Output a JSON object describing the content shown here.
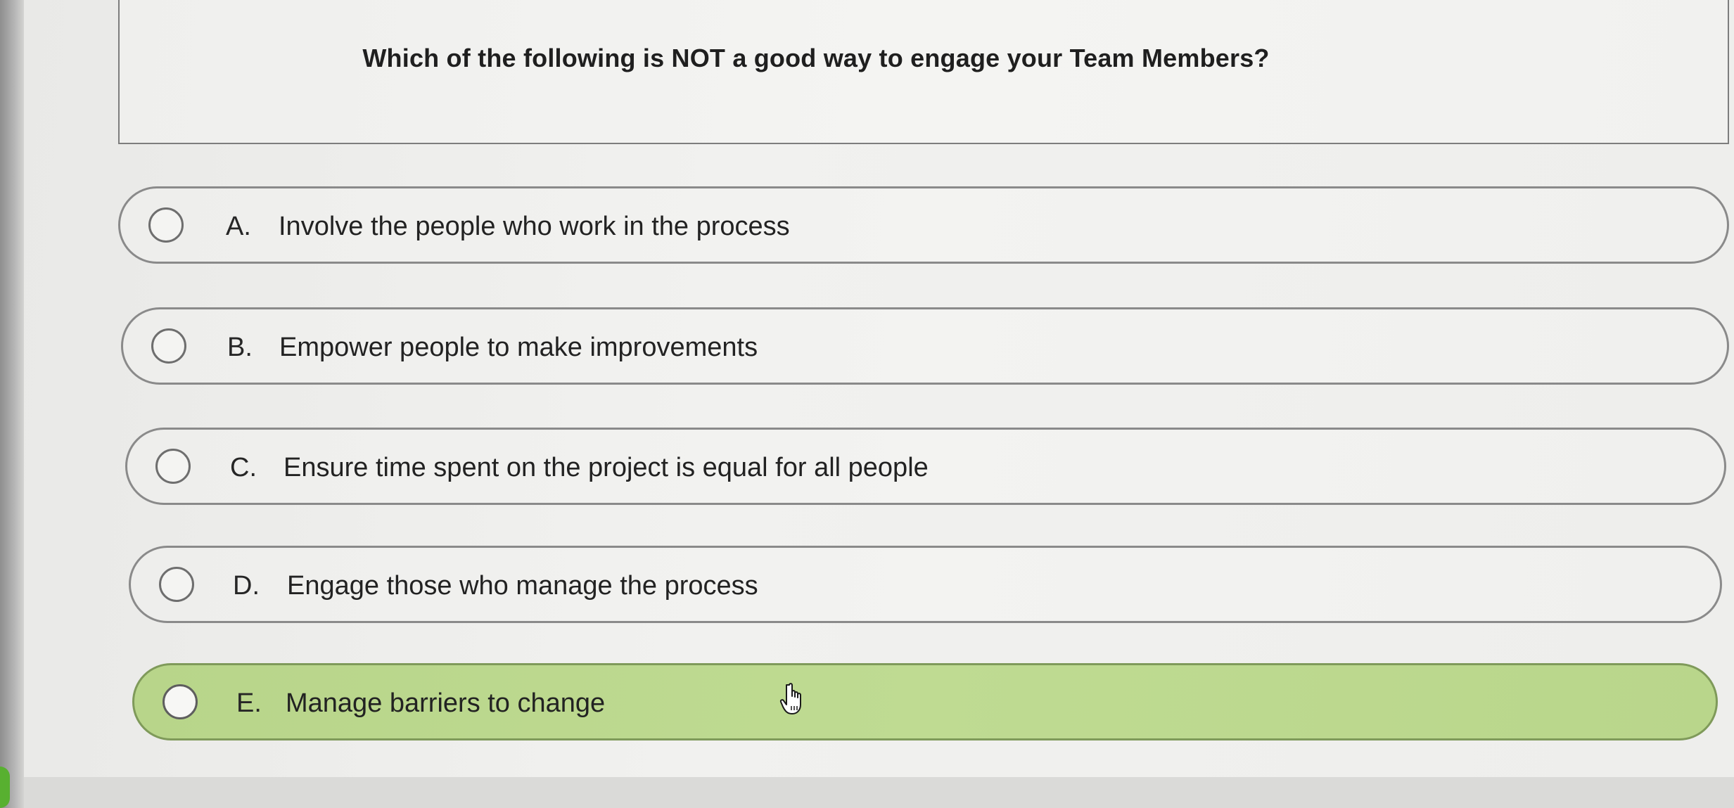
{
  "question": {
    "text": "Which of the following is NOT a good way to engage your Team Members?"
  },
  "options": [
    {
      "letter": "A.",
      "text": "Involve the people who work in the process",
      "selected": false
    },
    {
      "letter": "B.",
      "text": "Empower people to make improvements",
      "selected": false
    },
    {
      "letter": "C.",
      "text": "Ensure time spent on the project is equal for all people",
      "selected": false
    },
    {
      "letter": "D.",
      "text": "Engage those who manage the process",
      "selected": false
    },
    {
      "letter": "E.",
      "text": "Manage barriers to change",
      "selected": true
    }
  ],
  "colors": {
    "selected_fill": "#bcd98e",
    "option_border": "#8a8a8a"
  },
  "icons": {
    "cursor": "hand-pointer-icon",
    "radio": "radio-circle-icon"
  }
}
